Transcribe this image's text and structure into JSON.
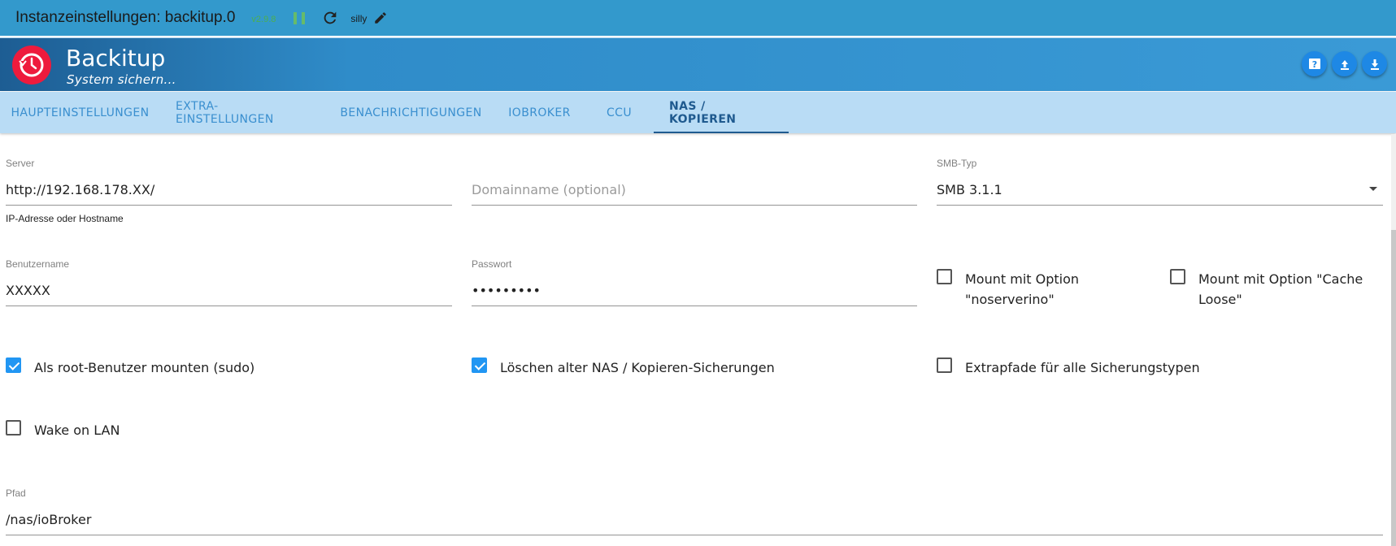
{
  "topbar": {
    "title": "Instanzeinstellungen: backitup.0",
    "version": "v2.9.8",
    "log_level": "silly"
  },
  "header": {
    "app_name": "Backitup",
    "subtitle": "System sichern..."
  },
  "tabs": [
    {
      "label": "Haupteinstellungen"
    },
    {
      "label": "Extra-Einstellungen"
    },
    {
      "label": "Benachrichtigungen"
    },
    {
      "label": "ioBroker"
    },
    {
      "label": "CCU"
    },
    {
      "label": "NAS / Kopieren"
    }
  ],
  "form": {
    "server": {
      "label": "Server",
      "value": "http://192.168.178.XX/",
      "help": "IP-Adresse oder Hostname"
    },
    "domain": {
      "placeholder": "Domainname (optional)"
    },
    "smb_type": {
      "label": "SMB-Typ",
      "value": "SMB 3.1.1"
    },
    "username": {
      "label": "Benutzername",
      "value": "XXXXX"
    },
    "password": {
      "label": "Passwort",
      "value": "•••••••••"
    },
    "noserverino": {
      "label": "Mount mit Option \"noserverino\"",
      "checked": false
    },
    "cache_loose": {
      "label": "Mount mit Option \"Cache Loose\"",
      "checked": false
    },
    "sudo": {
      "label": "Als root-Benutzer mounten (sudo)",
      "checked": true
    },
    "delete_old": {
      "label": "Löschen alter NAS / Kopieren-Sicherungen",
      "checked": true
    },
    "extra_paths": {
      "label": "Extrapfade für alle Sicherungstypen",
      "checked": false
    },
    "wol": {
      "label": "Wake on LAN",
      "checked": false
    },
    "path": {
      "label": "Pfad",
      "value": "/nas/ioBroker"
    }
  }
}
